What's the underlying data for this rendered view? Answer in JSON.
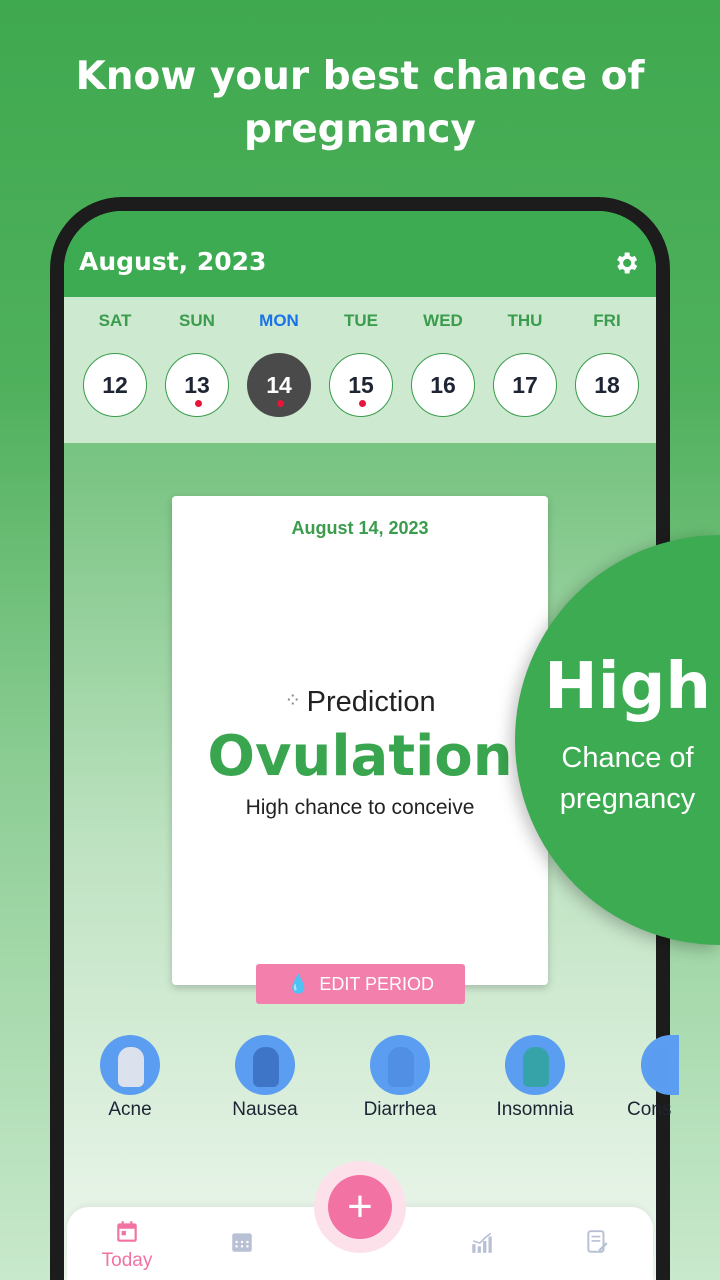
{
  "headline": "Know your best chance of pregnancy",
  "header": {
    "month": "August, 2023",
    "settings_icon": "gear-icon"
  },
  "week": [
    {
      "name": "SAT",
      "date": "12",
      "dot": false,
      "selected": false
    },
    {
      "name": "SUN",
      "date": "13",
      "dot": true,
      "selected": false
    },
    {
      "name": "MON",
      "date": "14",
      "dot": true,
      "selected": true
    },
    {
      "name": "TUE",
      "date": "15",
      "dot": true,
      "selected": false
    },
    {
      "name": "WED",
      "date": "16",
      "dot": false,
      "selected": false
    },
    {
      "name": "THU",
      "date": "17",
      "dot": false,
      "selected": false
    },
    {
      "name": "FRI",
      "date": "18",
      "dot": false,
      "selected": false
    }
  ],
  "card": {
    "date": "August 14, 2023",
    "prediction": "Prediction",
    "phase": "Ovulation",
    "chance": "High chance to conceive",
    "edit_label": "EDIT PERIOD"
  },
  "symptoms": [
    {
      "label": "Acne"
    },
    {
      "label": "Nausea"
    },
    {
      "label": "Diarrhea"
    },
    {
      "label": "Insomnia"
    },
    {
      "label": "Cons"
    }
  ],
  "nav": {
    "today": "Today"
  },
  "badge": {
    "title": "High",
    "line1": "Chance of",
    "line2": "pregnancy"
  },
  "colors": {
    "green": "#3dab52",
    "pink": "#f272a4",
    "selected": "#4a4a4a",
    "today_day": "#1a73e8",
    "dot": "#e8143c"
  }
}
